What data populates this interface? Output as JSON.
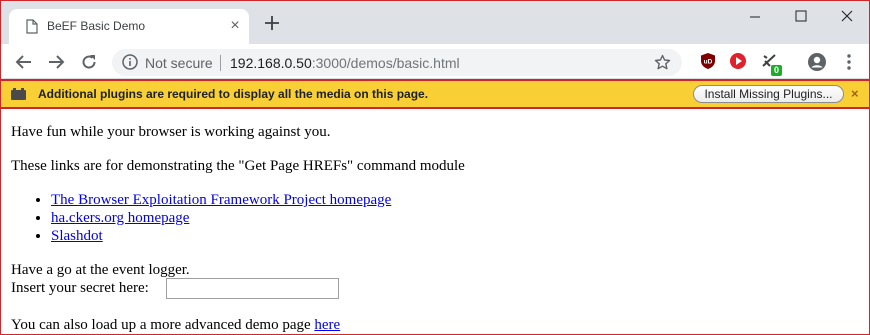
{
  "tab": {
    "title": "BeEF Basic Demo"
  },
  "omnibox": {
    "security_label": "Not secure",
    "url_host": "192.168.0.50",
    "url_rest": ":3000/demos/basic.html"
  },
  "extensions": {
    "badge_count": "0"
  },
  "infobar": {
    "message": "Additional plugins are required to display all the media on this page.",
    "install_button": "Install Missing Plugins...",
    "close": "×"
  },
  "page": {
    "intro": "Have fun while your browser is working against you.",
    "links_intro": "These links are for demonstrating the \"Get Page HREFs\" command module",
    "links": [
      "The Browser Exploitation Framework Project homepage",
      "ha.ckers.org homepage",
      "Slashdot"
    ],
    "logger_text": "Have a go at the event logger.",
    "secret_label": "Insert your secret here:",
    "secret_value": "",
    "advanced_text": "You can also load up a more advanced demo page ",
    "advanced_link": "here"
  },
  "colors": {
    "infobar_bg": "#f8d036",
    "highlight_border": "#d0262a",
    "link": "#0000ee",
    "ublock_red": "#800000",
    "play_red": "#e0202a",
    "badge_green": "#1cae28"
  }
}
